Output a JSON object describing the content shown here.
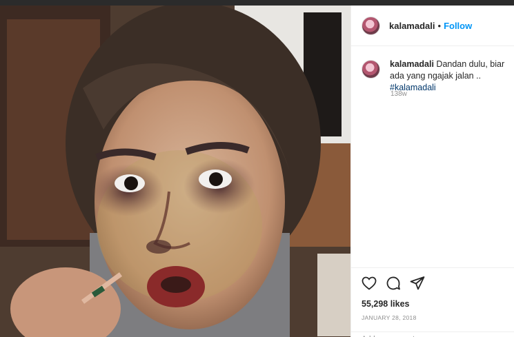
{
  "post": {
    "username": "kalamadali",
    "separator": "•",
    "follow_label": "Follow"
  },
  "caption": {
    "username": "kalamadali",
    "text": "Dandan dulu, biar ada yang ngajak jalan ..",
    "hashtag": "#kalamadali",
    "age": "138w"
  },
  "actions": {
    "like_icon": "heart-icon",
    "comment_icon": "comment-icon",
    "share_icon": "share-icon",
    "likes": "55,298 likes",
    "date": "JANUARY 28, 2018",
    "comment_placeholder": "Add a comment..."
  },
  "colors": {
    "accent": "#0095f6",
    "hashtag": "#00376b",
    "muted": "#8e8e8e",
    "text": "#262626"
  }
}
